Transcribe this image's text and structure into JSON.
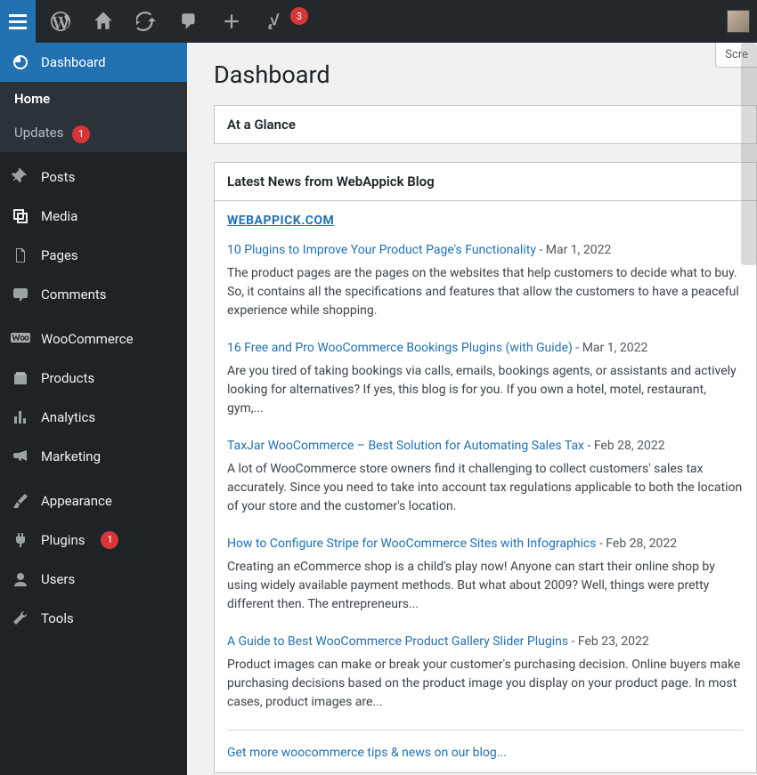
{
  "adminbar": {
    "notification_count": "3"
  },
  "screen_options_label": "Scre",
  "sidebar": {
    "dashboard": "Dashboard",
    "home": "Home",
    "updates": "Updates",
    "updates_badge": "1",
    "posts": "Posts",
    "media": "Media",
    "pages": "Pages",
    "comments": "Comments",
    "woocommerce": "WooCommerce",
    "products": "Products",
    "analytics": "Analytics",
    "marketing": "Marketing",
    "appearance": "Appearance",
    "plugins": "Plugins",
    "plugins_badge": "1",
    "users": "Users",
    "tools": "Tools"
  },
  "main": {
    "title": "Dashboard",
    "at_a_glance_title": "At a Glance",
    "news_box": {
      "title": "Latest News from WebAppick Blog",
      "brand": "WEBAPPICK.COM",
      "items": [
        {
          "title": "10 Plugins to Improve Your Product Page's Functionality",
          "date": "Mar 1, 2022",
          "excerpt": "The product pages are the pages on the websites that help customers to decide what to buy. So, it contains all the specifications and features that allow the customers to have a peaceful experience while shopping."
        },
        {
          "title": "16 Free and Pro WooCommerce Bookings Plugins (with Guide)",
          "date": "Mar 1, 2022",
          "excerpt": "Are you tired of taking bookings via calls, emails, bookings agents, or assistants and actively looking for alternatives? If yes, this blog is for you.  If you own a hotel, motel, restaurant, gym,..."
        },
        {
          "title": "TaxJar WooCommerce – Best Solution for Automating Sales Tax",
          "date": "Feb 28, 2022",
          "excerpt": "A lot of WooCommerce store owners find it challenging to collect customers' sales tax accurately. Since you need to take into account tax regulations applicable to both the location of your store and the customer's location."
        },
        {
          "title": "How to Configure Stripe for WooCommerce Sites with Infographics",
          "date": "Feb 28, 2022",
          "excerpt": "Creating an eCommerce shop is a child's play now! Anyone can start their online shop by using widely available payment methods.  But what about 2009? Well, things were pretty different then. The entrepreneurs..."
        },
        {
          "title": "A Guide to Best WooCommerce Product Gallery Slider Plugins",
          "date": "Feb 23, 2022",
          "excerpt": "Product images can make or break your customer's purchasing decision. Online buyers make purchasing decisions based on the product image you display on your product page. In most cases, product images are..."
        }
      ],
      "footer_link": "Get more woocommerce tips & news on our blog..."
    }
  }
}
